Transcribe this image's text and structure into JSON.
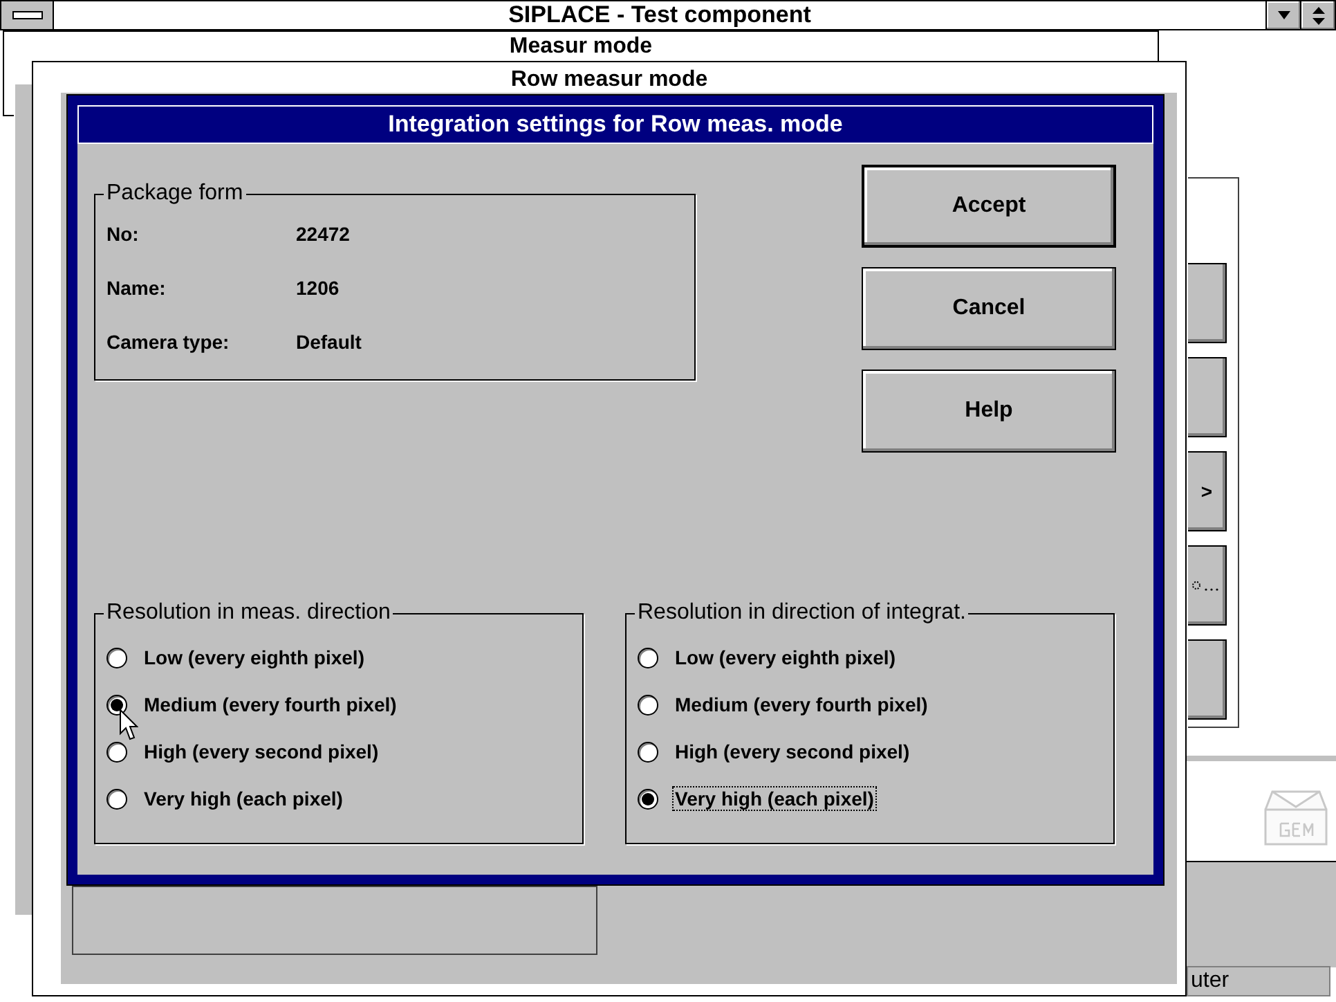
{
  "main_window": {
    "title": "SIPLACE - Test component"
  },
  "background_windows": [
    {
      "title": "Measur mode"
    },
    {
      "title": "Row measur mode"
    }
  ],
  "side_buttons": [
    {
      "kind": "blank"
    },
    {
      "kind": "blank"
    },
    {
      "kind": "text",
      "label": ">"
    },
    {
      "kind": "dots"
    },
    {
      "kind": "blank"
    }
  ],
  "status_bar": {
    "text": "uter"
  },
  "dialog": {
    "title": "Integration settings for Row meas. mode",
    "package_form": {
      "title": "Package form",
      "fields": [
        {
          "label": "No:",
          "value": "22472"
        },
        {
          "label": "Name:",
          "value": "1206"
        },
        {
          "label": "Camera type:",
          "value": "Default"
        }
      ]
    },
    "buttons": [
      {
        "label": "Accept",
        "default": true
      },
      {
        "label": "Cancel",
        "default": false
      },
      {
        "label": "Help",
        "default": false
      }
    ],
    "groups": [
      {
        "title": "Resolution in meas. direction",
        "options": [
          {
            "label": "Low (every eighth pixel)",
            "selected": false,
            "focused": false
          },
          {
            "label": "Medium (every fourth pixel)",
            "selected": true,
            "focused": false
          },
          {
            "label": "High (every second pixel)",
            "selected": false,
            "focused": false
          },
          {
            "label": "Very high (each pixel)",
            "selected": false,
            "focused": false
          }
        ]
      },
      {
        "title": "Resolution in direction of integrat.",
        "options": [
          {
            "label": "Low (every eighth pixel)",
            "selected": false,
            "focused": false
          },
          {
            "label": "Medium (every fourth pixel)",
            "selected": false,
            "focused": false
          },
          {
            "label": "High (every second pixel)",
            "selected": false,
            "focused": false
          },
          {
            "label": "Very high (each pixel)",
            "selected": true,
            "focused": true
          }
        ]
      }
    ]
  }
}
